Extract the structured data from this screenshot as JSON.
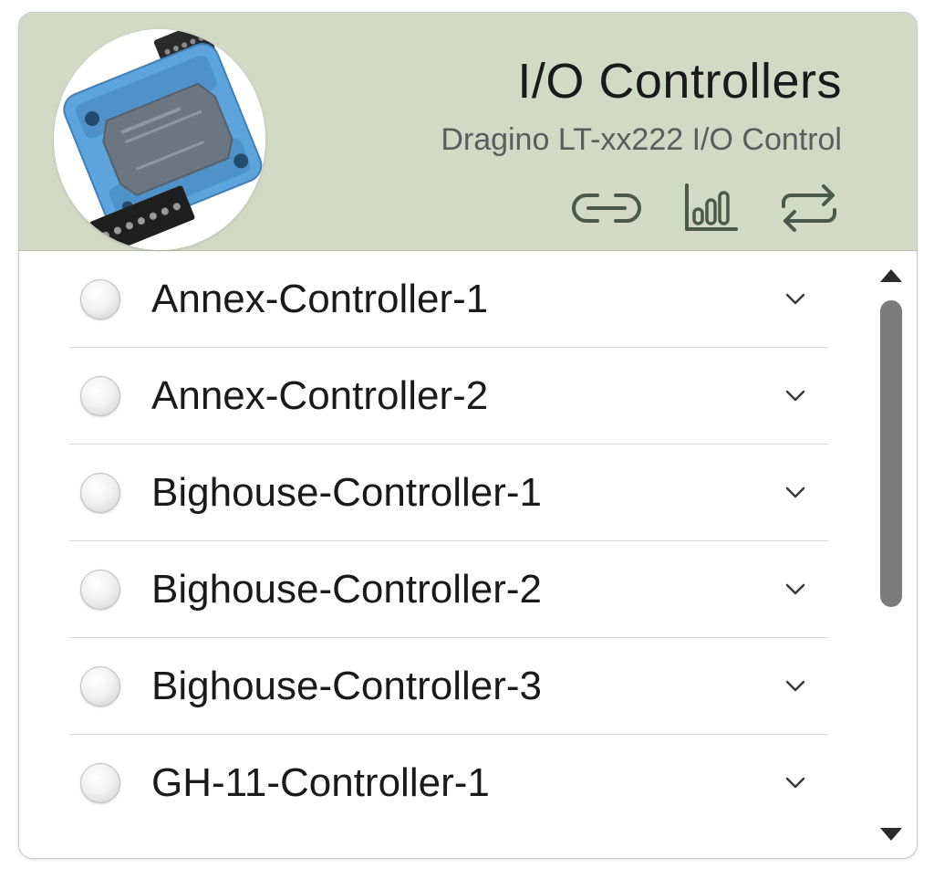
{
  "header": {
    "title": "I/O Controllers",
    "subtitle": "Dragino LT-xx222 I/O Control",
    "actions": [
      {
        "icon": "link-icon"
      },
      {
        "icon": "bar-chart-icon"
      },
      {
        "icon": "sync-icon"
      }
    ]
  },
  "controllers": [
    {
      "label": "Annex-Controller-1",
      "selected": false
    },
    {
      "label": "Annex-Controller-2",
      "selected": false
    },
    {
      "label": "Bighouse-Controller-1",
      "selected": false
    },
    {
      "label": "Bighouse-Controller-2",
      "selected": false
    },
    {
      "label": "Bighouse-Controller-3",
      "selected": false
    },
    {
      "label": "GH-11-Controller-1",
      "selected": false
    }
  ],
  "colors": {
    "header_bg": "#d2d9c4",
    "icon": "#4a5a4a",
    "device_body": "#5ea4dc"
  }
}
